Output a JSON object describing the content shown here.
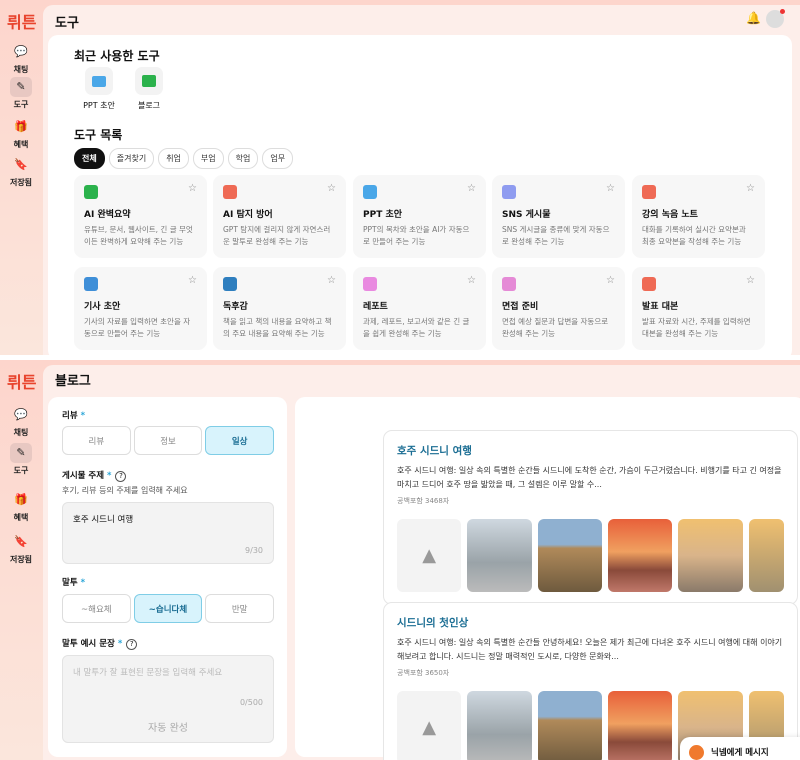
{
  "brand": "뤼튼",
  "nav": [
    {
      "label": "채팅",
      "icon": "chat-icon"
    },
    {
      "label": "도구",
      "icon": "magic-wand-icon"
    },
    {
      "label": "혜택",
      "icon": "gift-icon"
    },
    {
      "label": "저장됨",
      "icon": "bookmark-icon"
    }
  ],
  "tools_page": {
    "title": "도구",
    "recent_title": "최근 사용한 도구",
    "recent": [
      {
        "label": "PPT 초안",
        "color": "#4aa7e8"
      },
      {
        "label": "블로그",
        "color": "#2bb24c"
      }
    ],
    "list_title": "도구 목록",
    "filters": [
      "전체",
      "즐겨찾기",
      "취업",
      "부업",
      "학업",
      "업무"
    ],
    "tools": [
      {
        "name": "AI 완벽요약",
        "desc": "유튜브, 문서, 웹사이트, 긴 글 무엇이든 완벽하게 요약해 주는 기능",
        "color": "#2bb24c"
      },
      {
        "name": "AI 탐지 방어",
        "desc": "GPT 탐지에 걸리지 않게 자연스러운 말투로 완성해 주는 기능",
        "color": "#ef6a55"
      },
      {
        "name": "PPT 초안",
        "desc": "PPT의 목차와 초안을 AI가 자동으로 만들어 주는 기능",
        "color": "#4aa7e8"
      },
      {
        "name": "SNS 게시물",
        "desc": "SNS 게시글을 종류에 맞게 자동으로 완성해 주는 기능",
        "color": "#8f9cf0"
      },
      {
        "name": "강의 녹음 노트",
        "desc": "대화를 기록하여 실시간 요약본과 최종 요약본을 작성해 주는 기능",
        "color": "#ef6a55"
      },
      {
        "name": "기사 초안",
        "desc": "기사의 자료를 입력하면 초안을 자동으로 만들어 주는 기능",
        "color": "#3f8fd8"
      },
      {
        "name": "독후감",
        "desc": "책을 읽고 책의 내용을 요약하고 책의 주요 내용을 요약해 주는 기능",
        "color": "#2f7fbf"
      },
      {
        "name": "레포트",
        "desc": "과제, 레포트, 보고서와 같은 긴 글을 쉽게 완성해 주는 기능",
        "color": "#e98ae0"
      },
      {
        "name": "면접 준비",
        "desc": "면접 예상 질문과 답변을 자동으로 완성해 주는 기능",
        "color": "#e58ad6"
      },
      {
        "name": "발표 대본",
        "desc": "발표 자료와 시간, 주제를 입력하면 대본을 완성해 주는 기능",
        "color": "#ef6a55"
      }
    ]
  },
  "blog_page": {
    "title": "블로그",
    "type_label": "리뷰",
    "req": "*",
    "types": [
      "리뷰",
      "정보",
      "일상"
    ],
    "topic_label": "게시물 주제",
    "topic_hint": "후기, 리뷰 등의 주제를 입력해 주세요",
    "topic_value": "호주 시드니 여행",
    "topic_count": "9/30",
    "tone_label": "말투",
    "tones": [
      "~해요체",
      "~습니다체",
      "반말"
    ],
    "example_label": "말투 예시 문장",
    "example_placeholder": "내 말투가 잘 표현된 문장을 입력해 주세요",
    "example_count": "0/500",
    "autocomplete": "자동 완성",
    "results": [
      {
        "title": "호주 시드니 여행",
        "body": "호주 시드니 여행: 일상 속의 특별한 순간들 시드니에 도착한 순간, 가슴이 두근거렸습니다. 비행기를 타고 긴 여정을 마치고 드디어 호주 땅을 밟았을 때, 그 설렘은 이루 말할 수...",
        "count": "공백포함 3468자"
      },
      {
        "title": "시드니의 첫인상",
        "body": "호주 시드니 여행: 일상 속의 특별한 순간들 안녕하세요! 오늘은 제가 최근에 다녀온 호주 시드니 여행에 대해 이야기해보려고 합니다. 시드니는 정말 매력적인 도시로, 다양한 문화와...",
        "count": "공백포함 3650자"
      }
    ],
    "message": "닉넴에게 메시지"
  }
}
